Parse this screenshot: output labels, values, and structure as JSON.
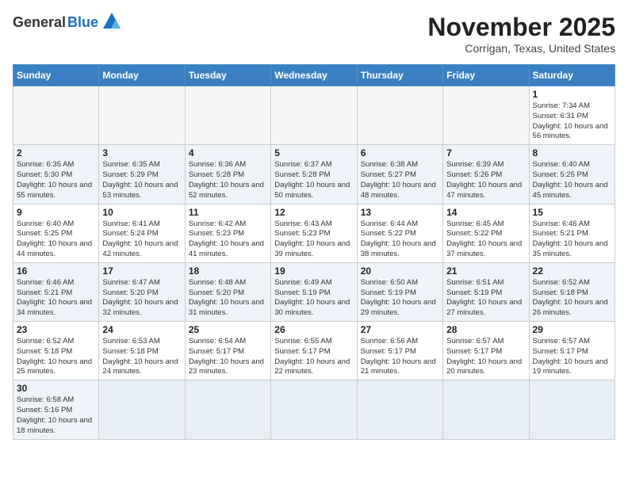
{
  "header": {
    "logo_general": "General",
    "logo_blue": "Blue",
    "month_title": "November 2025",
    "location": "Corrigan, Texas, United States"
  },
  "weekdays": [
    "Sunday",
    "Monday",
    "Tuesday",
    "Wednesday",
    "Thursday",
    "Friday",
    "Saturday"
  ],
  "weeks": [
    [
      {
        "day": "",
        "info": ""
      },
      {
        "day": "",
        "info": ""
      },
      {
        "day": "",
        "info": ""
      },
      {
        "day": "",
        "info": ""
      },
      {
        "day": "",
        "info": ""
      },
      {
        "day": "",
        "info": ""
      },
      {
        "day": "1",
        "info": "Sunrise: 7:34 AM\nSunset: 6:31 PM\nDaylight: 10 hours and 56 minutes."
      }
    ],
    [
      {
        "day": "2",
        "info": "Sunrise: 6:35 AM\nSunset: 5:30 PM\nDaylight: 10 hours and 55 minutes."
      },
      {
        "day": "3",
        "info": "Sunrise: 6:35 AM\nSunset: 5:29 PM\nDaylight: 10 hours and 53 minutes."
      },
      {
        "day": "4",
        "info": "Sunrise: 6:36 AM\nSunset: 5:28 PM\nDaylight: 10 hours and 52 minutes."
      },
      {
        "day": "5",
        "info": "Sunrise: 6:37 AM\nSunset: 5:28 PM\nDaylight: 10 hours and 50 minutes."
      },
      {
        "day": "6",
        "info": "Sunrise: 6:38 AM\nSunset: 5:27 PM\nDaylight: 10 hours and 48 minutes."
      },
      {
        "day": "7",
        "info": "Sunrise: 6:39 AM\nSunset: 5:26 PM\nDaylight: 10 hours and 47 minutes."
      },
      {
        "day": "8",
        "info": "Sunrise: 6:40 AM\nSunset: 5:25 PM\nDaylight: 10 hours and 45 minutes."
      }
    ],
    [
      {
        "day": "9",
        "info": "Sunrise: 6:40 AM\nSunset: 5:25 PM\nDaylight: 10 hours and 44 minutes."
      },
      {
        "day": "10",
        "info": "Sunrise: 6:41 AM\nSunset: 5:24 PM\nDaylight: 10 hours and 42 minutes."
      },
      {
        "day": "11",
        "info": "Sunrise: 6:42 AM\nSunset: 5:23 PM\nDaylight: 10 hours and 41 minutes."
      },
      {
        "day": "12",
        "info": "Sunrise: 6:43 AM\nSunset: 5:23 PM\nDaylight: 10 hours and 39 minutes."
      },
      {
        "day": "13",
        "info": "Sunrise: 6:44 AM\nSunset: 5:22 PM\nDaylight: 10 hours and 38 minutes."
      },
      {
        "day": "14",
        "info": "Sunrise: 6:45 AM\nSunset: 5:22 PM\nDaylight: 10 hours and 37 minutes."
      },
      {
        "day": "15",
        "info": "Sunrise: 6:46 AM\nSunset: 5:21 PM\nDaylight: 10 hours and 35 minutes."
      }
    ],
    [
      {
        "day": "16",
        "info": "Sunrise: 6:46 AM\nSunset: 5:21 PM\nDaylight: 10 hours and 34 minutes."
      },
      {
        "day": "17",
        "info": "Sunrise: 6:47 AM\nSunset: 5:20 PM\nDaylight: 10 hours and 32 minutes."
      },
      {
        "day": "18",
        "info": "Sunrise: 6:48 AM\nSunset: 5:20 PM\nDaylight: 10 hours and 31 minutes."
      },
      {
        "day": "19",
        "info": "Sunrise: 6:49 AM\nSunset: 5:19 PM\nDaylight: 10 hours and 30 minutes."
      },
      {
        "day": "20",
        "info": "Sunrise: 6:50 AM\nSunset: 5:19 PM\nDaylight: 10 hours and 29 minutes."
      },
      {
        "day": "21",
        "info": "Sunrise: 6:51 AM\nSunset: 5:19 PM\nDaylight: 10 hours and 27 minutes."
      },
      {
        "day": "22",
        "info": "Sunrise: 6:52 AM\nSunset: 5:18 PM\nDaylight: 10 hours and 26 minutes."
      }
    ],
    [
      {
        "day": "23",
        "info": "Sunrise: 6:52 AM\nSunset: 5:18 PM\nDaylight: 10 hours and 25 minutes."
      },
      {
        "day": "24",
        "info": "Sunrise: 6:53 AM\nSunset: 5:18 PM\nDaylight: 10 hours and 24 minutes."
      },
      {
        "day": "25",
        "info": "Sunrise: 6:54 AM\nSunset: 5:17 PM\nDaylight: 10 hours and 23 minutes."
      },
      {
        "day": "26",
        "info": "Sunrise: 6:55 AM\nSunset: 5:17 PM\nDaylight: 10 hours and 22 minutes."
      },
      {
        "day": "27",
        "info": "Sunrise: 6:56 AM\nSunset: 5:17 PM\nDaylight: 10 hours and 21 minutes."
      },
      {
        "day": "28",
        "info": "Sunrise: 6:57 AM\nSunset: 5:17 PM\nDaylight: 10 hours and 20 minutes."
      },
      {
        "day": "29",
        "info": "Sunrise: 6:57 AM\nSunset: 5:17 PM\nDaylight: 10 hours and 19 minutes."
      }
    ],
    [
      {
        "day": "30",
        "info": "Sunrise: 6:58 AM\nSunset: 5:16 PM\nDaylight: 10 hours and 18 minutes."
      },
      {
        "day": "",
        "info": ""
      },
      {
        "day": "",
        "info": ""
      },
      {
        "day": "",
        "info": ""
      },
      {
        "day": "",
        "info": ""
      },
      {
        "day": "",
        "info": ""
      },
      {
        "day": "",
        "info": ""
      }
    ]
  ]
}
